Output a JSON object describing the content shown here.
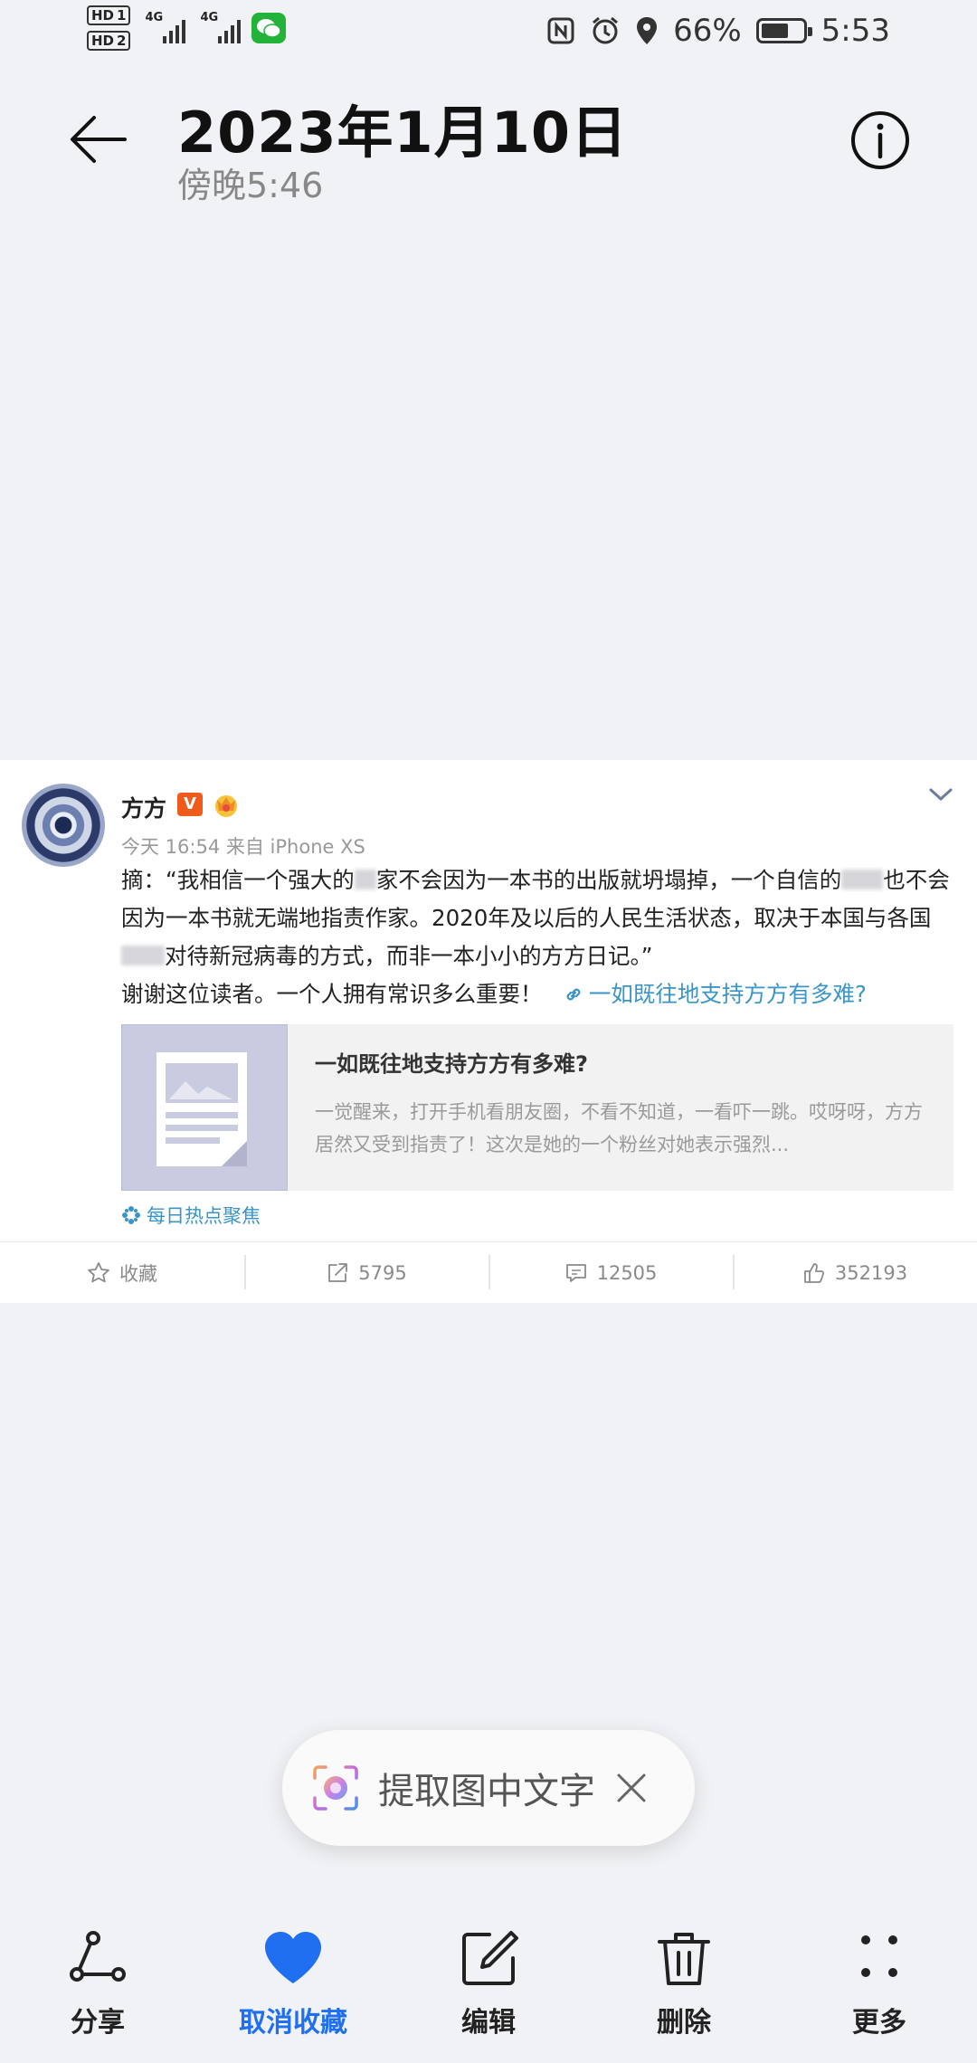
{
  "status_bar": {
    "hd1": "HD",
    "hd1_num": "1",
    "hd2": "HD",
    "hd2_num": "2",
    "network1": "4G",
    "network2": "4G",
    "battery_percent": "66%",
    "battery_level": 0.66,
    "time": "5:53"
  },
  "header": {
    "date": "2023年1月10日",
    "time": "傍晚5:46"
  },
  "post": {
    "author": "方方",
    "verified_badge": "V",
    "meta": "今天 16:54 来自 iPhone XS",
    "body_1": "摘：“我相信一个强大的",
    "body_2": "家不会因为一本书的出版就坍塌掉，一个自信的",
    "body_3": "也不会因为一本书就无端地指责作家。2020年及以后的人民生活状态，取决于本国与各国",
    "body_4": "对待新冠病毒的方式，而非一本小小的方方日记。”",
    "body_5": "谢谢这位读者。一个人拥有常识多么重要！",
    "link_text": "一如既往地支持方方有多难?",
    "preview_title": "一如既往地支持方方有多难?",
    "preview_desc": "一觉醒来，打开手机看朋友圈，不看不知道，一看吓一跳。哎呀呀，方方居然又受到指责了！这次是她的一个粉丝对她表示强烈...",
    "topic_tag": "每日热点聚焦",
    "actions": {
      "favorite_label": "收藏",
      "reposts": "5795",
      "comments": "12505",
      "likes": "352193"
    }
  },
  "extract_pill": {
    "label": "提取图中文字"
  },
  "bottom_bar": {
    "share": "分享",
    "unfavorite": "取消收藏",
    "edit": "编辑",
    "delete": "删除",
    "more": "更多"
  },
  "colors": {
    "accent_blue": "#1f6ff0",
    "link_blue": "#3a95c7",
    "wechat_green": "#23b33a",
    "verified_orange": "#f05a1a"
  }
}
